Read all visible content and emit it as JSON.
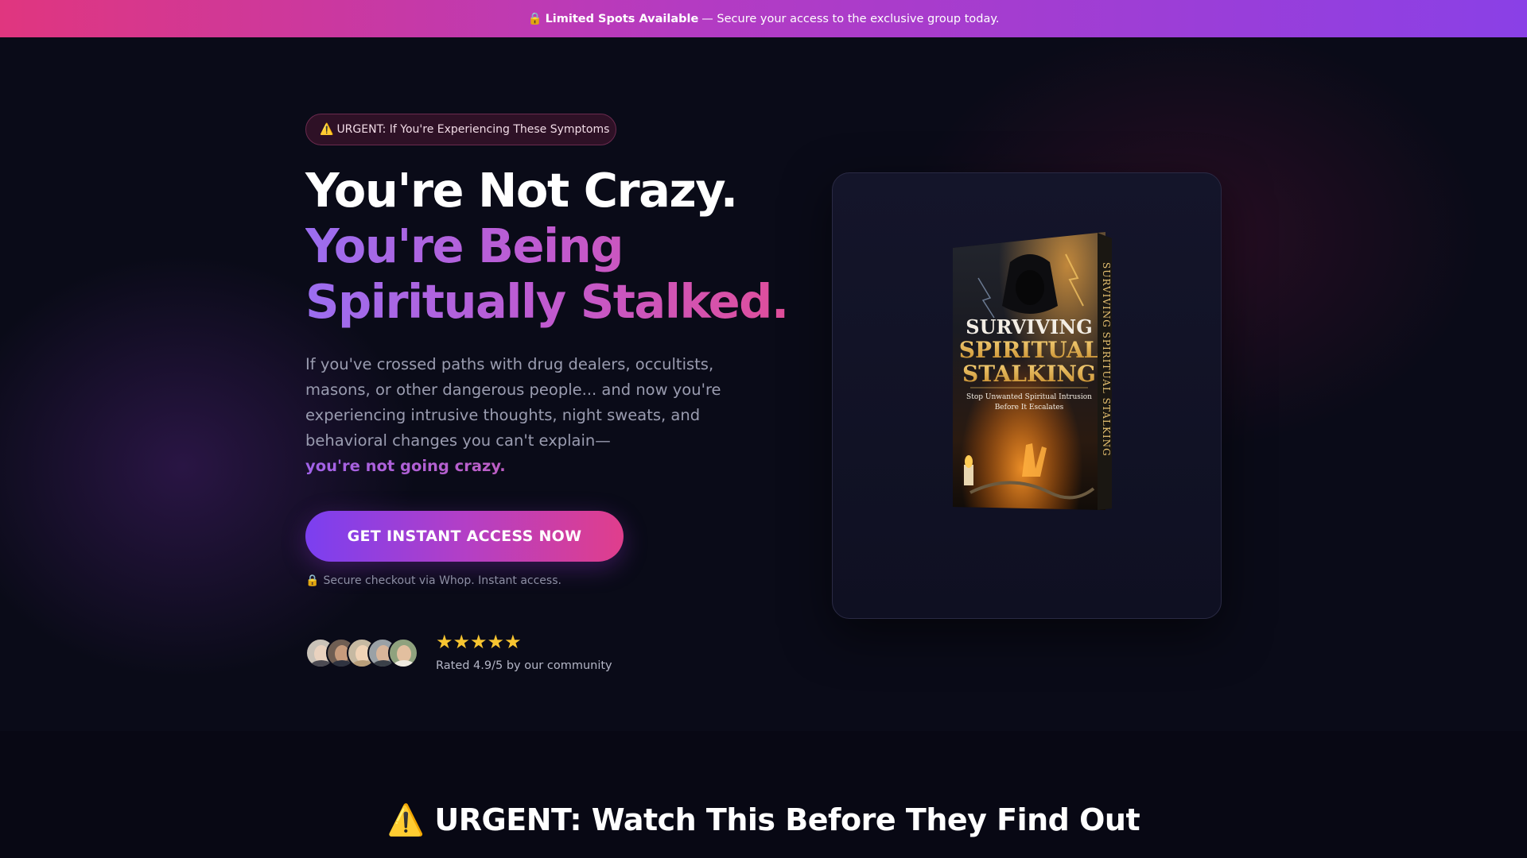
{
  "announcement": {
    "icon": "lock-icon",
    "bold": "Limited Spots Available",
    "rest": "— Secure your access to the exclusive group today."
  },
  "hero": {
    "badge": {
      "icon": "warning-icon",
      "text": "URGENT: If You're Experiencing These Symptoms"
    },
    "headline_line1": "You're Not Crazy.",
    "headline_line2": "You're Being",
    "headline_line3": "Spiritually Stalked.",
    "description": "If you've crossed paths with drug dealers, occultists, masons, or other dangerous people... and now you're experiencing intrusive thoughts, night sweats, and behavioral changes you can't explain—",
    "description_highlight": "you're not going crazy.",
    "cta_label": "GET INSTANT ACCESS NOW",
    "secure_note": "Secure checkout via Whop. Instant access.",
    "stars": "★★★★★",
    "rating_value": 4.9,
    "rating_text": "Rated 4.9/5 by our community",
    "avatar_count": 5
  },
  "book": {
    "title_line1": "SURVIVING",
    "title_line2": "SPIRITUAL",
    "title_line3": "STALKING",
    "subtitle_line1": "Stop Unwanted Spiritual Intrusion",
    "subtitle_line2": "Before It Escalates",
    "spine": "SURVIVING SPIRITUAL STALKING"
  },
  "section2": {
    "icon": "warning-icon",
    "headline": "URGENT: Watch This Before They Find Out"
  },
  "colors": {
    "accent_purple": "#8a40e6",
    "accent_pink": "#e0367f",
    "star": "#f7c531",
    "background": "#0a0b18"
  }
}
